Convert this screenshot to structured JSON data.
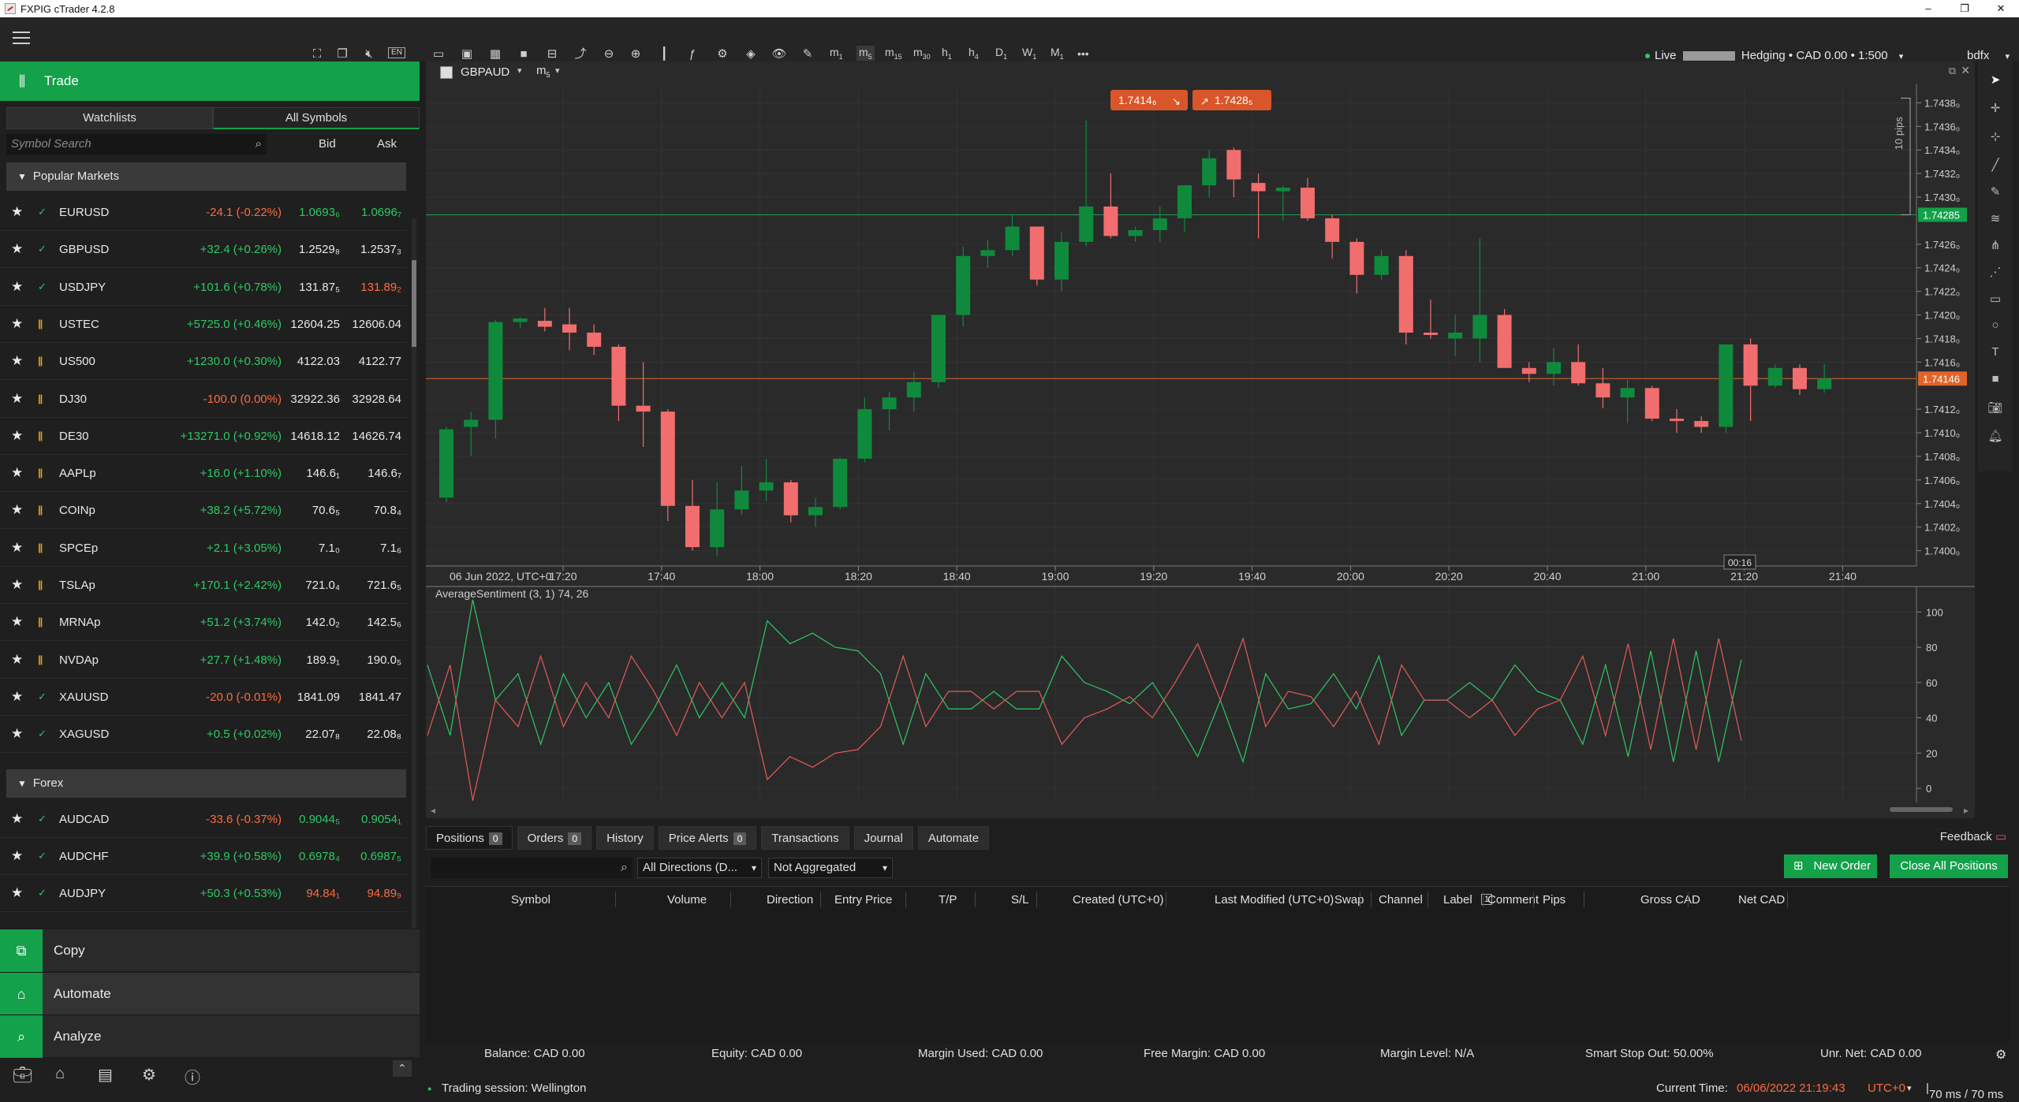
{
  "window": {
    "title": "FXPIG cTrader 4.2.8"
  },
  "toolbar": {
    "timeframes": [
      {
        "label": "m",
        "sub": "1"
      },
      {
        "label": "m",
        "sub": "5"
      },
      {
        "label": "m",
        "sub": "15"
      },
      {
        "label": "m",
        "sub": "30"
      },
      {
        "label": "h",
        "sub": "1"
      },
      {
        "label": "h",
        "sub": "4"
      },
      {
        "label": "D",
        "sub": "1"
      },
      {
        "label": "W",
        "sub": "1"
      },
      {
        "label": "M",
        "sub": "1"
      }
    ],
    "more": "•••",
    "account": {
      "mode": "Live",
      "type": "Hedging",
      "balance": "CAD 0.00",
      "leverage": "1:500"
    },
    "user": "bdfx"
  },
  "sidebar": {
    "trade_label": "Trade",
    "tabs": [
      "Watchlists",
      "All Symbols"
    ],
    "search_placeholder": "Symbol Search",
    "bid_header": "Bid",
    "ask_header": "Ask",
    "groups": [
      {
        "name": "Popular Markets",
        "rows": [
          {
            "status": "open",
            "symbol": "EURUSD",
            "change": "-24.1 (-0.22%)",
            "dir": "neg",
            "bid": "1.0693₆",
            "ask": "1.0696₇",
            "bidc": "pos",
            "askc": "pos"
          },
          {
            "status": "open",
            "symbol": "GBPUSD",
            "change": "+32.4 (+0.26%)",
            "dir": "pos",
            "bid": "1.2529₈",
            "ask": "1.2537₃",
            "bidc": "wht",
            "askc": "wht"
          },
          {
            "status": "open",
            "symbol": "USDJPY",
            "change": "+101.6 (+0.78%)",
            "dir": "pos",
            "bid": "131.87₅",
            "ask": "131.89₂",
            "bidc": "wht",
            "askc": "neg"
          },
          {
            "status": "paused",
            "symbol": "USTEC",
            "change": "+5725.0 (+0.46%)",
            "dir": "pos",
            "bid": "12604.25",
            "ask": "12606.04",
            "bidc": "wht",
            "askc": "wht"
          },
          {
            "status": "paused",
            "symbol": "US500",
            "change": "+1230.0 (+0.30%)",
            "dir": "pos",
            "bid": "4122.03",
            "ask": "4122.77",
            "bidc": "wht",
            "askc": "wht"
          },
          {
            "status": "paused",
            "symbol": "DJ30",
            "change": "-100.0 (0.00%)",
            "dir": "neg",
            "bid": "32922.36",
            "ask": "32928.64",
            "bidc": "wht",
            "askc": "wht"
          },
          {
            "status": "paused",
            "symbol": "DE30",
            "change": "+13271.0 (+0.92%)",
            "dir": "pos",
            "bid": "14618.12",
            "ask": "14626.74",
            "bidc": "wht",
            "askc": "wht"
          },
          {
            "status": "paused",
            "symbol": "AAPLp",
            "change": "+16.0 (+1.10%)",
            "dir": "pos",
            "bid": "146.6₁",
            "ask": "146.6₇",
            "bidc": "wht",
            "askc": "wht"
          },
          {
            "status": "paused",
            "symbol": "COINp",
            "change": "+38.2 (+5.72%)",
            "dir": "pos",
            "bid": "70.6₅",
            "ask": "70.8₄",
            "bidc": "wht",
            "askc": "wht"
          },
          {
            "status": "paused",
            "symbol": "SPCEp",
            "change": "+2.1 (+3.05%)",
            "dir": "pos",
            "bid": "7.1₀",
            "ask": "7.1₆",
            "bidc": "wht",
            "askc": "wht"
          },
          {
            "status": "paused",
            "symbol": "TSLAp",
            "change": "+170.1 (+2.42%)",
            "dir": "pos",
            "bid": "721.0₄",
            "ask": "721.6₅",
            "bidc": "wht",
            "askc": "wht"
          },
          {
            "status": "paused",
            "symbol": "MRNAp",
            "change": "+51.2 (+3.74%)",
            "dir": "pos",
            "bid": "142.0₂",
            "ask": "142.5₆",
            "bidc": "wht",
            "askc": "wht"
          },
          {
            "status": "paused",
            "symbol": "NVDAp",
            "change": "+27.7 (+1.48%)",
            "dir": "pos",
            "bid": "189.9₁",
            "ask": "190.0₅",
            "bidc": "wht",
            "askc": "wht"
          },
          {
            "status": "open",
            "symbol": "XAUUSD",
            "change": "-20.0 (-0.01%)",
            "dir": "neg",
            "bid": "1841.09",
            "ask": "1841.47",
            "bidc": "wht",
            "askc": "wht"
          },
          {
            "status": "open",
            "symbol": "XAGUSD",
            "change": "+0.5 (+0.02%)",
            "dir": "pos",
            "bid": "22.07₈",
            "ask": "22.08₈",
            "bidc": "wht",
            "askc": "wht"
          }
        ]
      },
      {
        "name": "Forex",
        "rows": [
          {
            "status": "open",
            "symbol": "AUDCAD",
            "change": "-33.6 (-0.37%)",
            "dir": "neg",
            "bid": "0.9044₅",
            "ask": "0.9054₁",
            "bidc": "pos",
            "askc": "pos"
          },
          {
            "status": "open",
            "symbol": "AUDCHF",
            "change": "+39.9 (+0.58%)",
            "dir": "pos",
            "bid": "0.6978₄",
            "ask": "0.6987₅",
            "bidc": "pos",
            "askc": "pos"
          },
          {
            "status": "open",
            "symbol": "AUDJPY",
            "change": "+50.3 (+0.53%)",
            "dir": "pos",
            "bid": "94.84₁",
            "ask": "94.89₉",
            "bidc": "neg",
            "askc": "neg"
          }
        ]
      }
    ],
    "apps": [
      "Copy",
      "Automate",
      "Analyze"
    ]
  },
  "chart": {
    "symbol": "GBPAUD",
    "timeframe": {
      "label": "m",
      "sub": "5"
    },
    "sell_price": "1.7414₆",
    "buy_price": "1.7428₅",
    "pips_label": "10 pips",
    "ask_marker": "1.74285",
    "bid_marker": "1.74146",
    "countdown": "00:16",
    "indicator_label": "AverageSentiment (3, 1) 74, 26"
  },
  "chart_data": [
    {
      "type": "candlestick",
      "title": "GBPAUD m5",
      "y_ticks": [
        "1.7438₀",
        "1.7436₀",
        "1.7434₀",
        "1.7432₀",
        "1.7430₀",
        "1.7426₀",
        "1.7424₀",
        "1.7422₀",
        "1.7420₀",
        "1.7418₀",
        "1.7416₀",
        "1.7412₀",
        "1.7410₀",
        "1.7408₀",
        "1.7406₀",
        "1.7404₀",
        "1.7402₀",
        "1.7400₀"
      ],
      "ylim": [
        1.73987,
        1.74395
      ],
      "x_labels": [
        "06 Jun 2022, UTC+0",
        "17:20",
        "17:40",
        "18:00",
        "18:20",
        "18:40",
        "19:00",
        "19:20",
        "19:40",
        "20:00",
        "20:20",
        "20:40",
        "21:00",
        "21:20",
        "21:40"
      ],
      "candles": [
        [
          1.74045,
          1.74105,
          1.74041,
          1.74103
        ],
        [
          1.74105,
          1.74118,
          1.7408,
          1.74111
        ],
        [
          1.74111,
          1.74196,
          1.74095,
          1.74194
        ],
        [
          1.74194,
          1.74198,
          1.74189,
          1.74197
        ],
        [
          1.74195,
          1.74206,
          1.74186,
          1.7419
        ],
        [
          1.74192,
          1.74206,
          1.7417,
          1.74185
        ],
        [
          1.74185,
          1.74192,
          1.74166,
          1.74173
        ],
        [
          1.74173,
          1.74175,
          1.7411,
          1.74123
        ],
        [
          1.74123,
          1.7416,
          1.74088,
          1.74118
        ],
        [
          1.74118,
          1.7412,
          1.74025,
          1.74038
        ],
        [
          1.74038,
          1.7406,
          1.74,
          1.74003
        ],
        [
          1.74003,
          1.74058,
          1.73995,
          1.74035
        ],
        [
          1.74035,
          1.74072,
          1.7403,
          1.74051
        ],
        [
          1.74051,
          1.74078,
          1.74042,
          1.74058
        ],
        [
          1.74058,
          1.7406,
          1.74024,
          1.7403
        ],
        [
          1.7403,
          1.74045,
          1.7402,
          1.74037
        ],
        [
          1.74037,
          1.74079,
          1.74035,
          1.74078
        ],
        [
          1.74078,
          1.7413,
          1.74075,
          1.7412
        ],
        [
          1.7412,
          1.74135,
          1.74102,
          1.7413
        ],
        [
          1.7413,
          1.74152,
          1.74118,
          1.74143
        ],
        [
          1.74143,
          1.742,
          1.74138,
          1.742
        ],
        [
          1.742,
          1.74258,
          1.7419,
          1.7425
        ],
        [
          1.7425,
          1.74264,
          1.7424,
          1.74255
        ],
        [
          1.74255,
          1.74285,
          1.7425,
          1.74275
        ],
        [
          1.74275,
          1.74275,
          1.74225,
          1.7423
        ],
        [
          1.7423,
          1.7427,
          1.7422,
          1.74262
        ],
        [
          1.74262,
          1.74365,
          1.74258,
          1.74292
        ],
        [
          1.74292,
          1.7432,
          1.74265,
          1.74267
        ],
        [
          1.74267,
          1.74275,
          1.74262,
          1.74272
        ],
        [
          1.74272,
          1.74292,
          1.74262,
          1.74282
        ],
        [
          1.74282,
          1.743,
          1.7427,
          1.7431
        ],
        [
          1.7431,
          1.7434,
          1.743,
          1.74333
        ],
        [
          1.7434,
          1.74342,
          1.743,
          1.74315
        ],
        [
          1.74312,
          1.7432,
          1.74265,
          1.74305
        ],
        [
          1.74305,
          1.7431,
          1.7428,
          1.74308
        ],
        [
          1.74308,
          1.74316,
          1.7428,
          1.74282
        ],
        [
          1.74282,
          1.74285,
          1.74248,
          1.74262
        ],
        [
          1.74262,
          1.74265,
          1.74218,
          1.74234
        ],
        [
          1.74234,
          1.74255,
          1.7423,
          1.7425
        ],
        [
          1.7425,
          1.74255,
          1.74175,
          1.74185
        ],
        [
          1.74185,
          1.74213,
          1.7418,
          1.74183
        ],
        [
          1.7418,
          1.742,
          1.74165,
          1.74185
        ],
        [
          1.7418,
          1.74265,
          1.7416,
          1.742
        ],
        [
          1.742,
          1.74205,
          1.7418,
          1.74155
        ],
        [
          1.74155,
          1.7416,
          1.74143,
          1.7415
        ],
        [
          1.7415,
          1.74172,
          1.7414,
          1.7416
        ],
        [
          1.7416,
          1.74175,
          1.7414,
          1.74142
        ],
        [
          1.74142,
          1.74155,
          1.74121,
          1.7413
        ],
        [
          1.7413,
          1.74145,
          1.74108,
          1.74138
        ],
        [
          1.74138,
          1.7414,
          1.7411,
          1.74112
        ],
        [
          1.74112,
          1.7412,
          1.741,
          1.7411
        ],
        [
          1.7411,
          1.74114,
          1.741,
          1.74105
        ],
        [
          1.74105,
          1.74175,
          1.741,
          1.74175
        ],
        [
          1.74175,
          1.7418,
          1.7411,
          1.7414
        ],
        [
          1.7414,
          1.74158,
          1.74138,
          1.74155
        ],
        [
          1.74155,
          1.74158,
          1.74132,
          1.74137
        ],
        [
          1.74137,
          1.74158,
          1.74134,
          1.74146
        ]
      ]
    },
    {
      "type": "line",
      "title": "AverageSentiment (3, 1) 74, 26",
      "y_ticks": [
        "100",
        "80",
        "60",
        "40",
        "20",
        "0"
      ],
      "ylim": [
        -8,
        110
      ],
      "series": [
        {
          "name": "buy",
          "color": "#2ec866",
          "values": [
            70,
            30,
            107,
            50,
            65,
            25,
            65,
            40,
            60,
            25,
            45,
            70,
            40,
            60,
            40,
            95,
            82,
            88,
            80,
            78,
            65,
            25,
            65,
            45,
            45,
            55,
            45,
            45,
            75,
            60,
            55,
            48,
            60,
            40,
            18,
            50,
            15,
            65,
            45,
            48,
            65,
            45,
            75,
            30,
            50,
            50,
            60,
            50,
            70,
            55,
            50,
            25,
            70,
            18,
            78,
            15,
            78,
            15,
            73
          ]
        },
        {
          "name": "sell",
          "color": "#e65a5a",
          "values": [
            30,
            70,
            -7,
            50,
            35,
            75,
            35,
            60,
            40,
            75,
            55,
            30,
            60,
            40,
            60,
            5,
            18,
            12,
            20,
            22,
            35,
            75,
            35,
            55,
            55,
            45,
            55,
            55,
            25,
            40,
            45,
            52,
            40,
            60,
            82,
            50,
            85,
            35,
            55,
            52,
            35,
            55,
            25,
            70,
            50,
            50,
            40,
            50,
            30,
            45,
            50,
            75,
            30,
            82,
            22,
            85,
            22,
            85,
            27
          ]
        }
      ]
    }
  ],
  "bottom_panel": {
    "tabs": [
      {
        "label": "Positions",
        "count": "0"
      },
      {
        "label": "Orders",
        "count": "0"
      },
      {
        "label": "History"
      },
      {
        "label": "Price Alerts",
        "count": "0"
      },
      {
        "label": "Transactions"
      },
      {
        "label": "Journal"
      },
      {
        "label": "Automate"
      }
    ],
    "feedback": "Feedback",
    "direction_filter": "All Directions (D...",
    "aggregation_filter": "Not Aggregated",
    "new_order": "New Order",
    "close_all": "Close All Positions",
    "columns": [
      "Symbol",
      "Volume",
      "Direction",
      "Entry Price",
      "T/P",
      "S/L",
      "Created (UTC+0)",
      "Last Modified (UTC+0)",
      "Swap",
      "Channel",
      "Label",
      "Comment",
      "Pips",
      "Gross CAD",
      "Net CAD"
    ],
    "label_count": "1",
    "status": {
      "balance": "Balance: CAD 0.00",
      "equity": "Equity: CAD 0.00",
      "margin_used": "Margin Used: CAD 0.00",
      "free_margin": "Free Margin: CAD 0.00",
      "margin_level": "Margin Level: N/A",
      "smart_stop": "Smart Stop Out: 50.00%",
      "unr_net": "Unr. Net:  CAD 0.00"
    }
  },
  "footer": {
    "session": "Trading session: Wellington",
    "current_time_label": "Current Time:",
    "current_time": "06/06/2022 21:19:43",
    "tz": "UTC+0",
    "latency": "70 ms / 70 ms"
  }
}
